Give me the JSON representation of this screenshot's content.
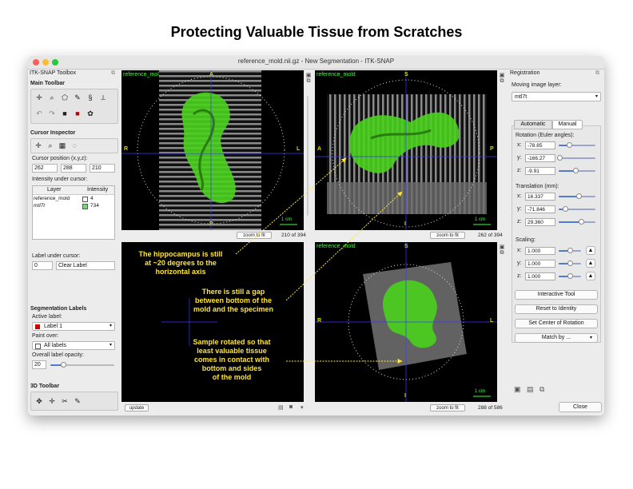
{
  "slide_title": "Protecting Valuable Tissue from Scratches",
  "window": {
    "title": "reference_mold.nii.gz - New Segmentation - ITK-SNAP",
    "colors": {
      "close": "#ff5f57",
      "minimize": "#febc2e",
      "maximize": "#28c840"
    }
  },
  "left_panel": {
    "title": "ITK-SNAP Toolbox",
    "main_toolbar": "Main Toolbar",
    "cursor_inspector": "Cursor Inspector",
    "cursor_position_label": "Cursor position (x,y,z):",
    "cursor_x": "262",
    "cursor_y": "288",
    "cursor_z": "210",
    "intensity_label": "Intensity under cursor:",
    "table_headers": [
      "Layer",
      "Intensity"
    ],
    "layers": [
      {
        "name": "reference_mold",
        "intensity": "4"
      },
      {
        "name": "mtl7t",
        "intensity": "734"
      }
    ],
    "label_under_cursor": "Label under cursor:",
    "label_value": "0",
    "label_name": "Clear Label",
    "segmentation_labels": "Segmentation Labels",
    "active_label_caption": "Active label:",
    "active_label": "Label 1",
    "paint_over_caption": "Paint over:",
    "paint_over": "All labels",
    "opacity_caption": "Overall label opacity:",
    "opacity_value": "20",
    "toolbar_3d": "3D Toolbar"
  },
  "views": {
    "top_left": {
      "label": "",
      "slice": "210 of 394",
      "zoom": "zoom to fit",
      "scale": "1 cm",
      "orient": {
        "top": "A",
        "bottom": "P",
        "left": "R",
        "right": "L"
      }
    },
    "top_right": {
      "label": "reference_mold",
      "slice": "262 of 394",
      "zoom": "zoom to fit",
      "scale": "1 cm",
      "orient": {
        "top": "S",
        "bottom": "I",
        "left": "A",
        "right": "P"
      }
    },
    "bottom_left": {
      "label": "reference_mold",
      "update": "update"
    },
    "bottom_right": {
      "label": "reference_mold",
      "slice": "288 of 586",
      "zoom": "zoom to fit",
      "scale": "1 cm",
      "orient": {
        "top": "S",
        "bottom": "I",
        "left": "R",
        "right": "L"
      }
    }
  },
  "top_left_label": "reference_mold",
  "annotations": {
    "a1": [
      "The hippocampus is still",
      "at ~20 degrees to the",
      "horizontal axis"
    ],
    "a2": [
      "There is still a gap",
      "between bottom of the",
      "mold and the specimen"
    ],
    "a3": [
      "Sample rotated so that",
      "least valuable tissue",
      "comes in contact with",
      "bottom and sides",
      "of the mold"
    ]
  },
  "right_panel": {
    "title": "Registration",
    "moving_label": "Moving image layer:",
    "moving_value": "mtl7t",
    "tabs": [
      "Automatic",
      "Manual"
    ],
    "rotation_label": "Rotation (Euler angles):",
    "rotation": [
      {
        "axis": "x:",
        "value": "-78.85",
        "level": 0.28
      },
      {
        "axis": "y:",
        "value": "-166.27",
        "level": 0.03
      },
      {
        "axis": "z:",
        "value": "-9.91",
        "level": 0.45
      }
    ],
    "translation_label": "Translation (mm):",
    "translation": [
      {
        "axis": "x:",
        "value": "16.337",
        "level": 0.55
      },
      {
        "axis": "y:",
        "value": "-71.846",
        "level": 0.18
      },
      {
        "axis": "z:",
        "value": "29.360",
        "level": 0.6
      }
    ],
    "scaling_label": "Scaling:",
    "scaling": [
      {
        "axis": "x:",
        "value": "1.000",
        "level": 0.5
      },
      {
        "axis": "y:",
        "value": "1.000",
        "level": 0.5
      },
      {
        "axis": "z:",
        "value": "1.000",
        "level": 0.5
      }
    ],
    "interactive_tool": "Interactive Tool",
    "reset": "Reset to Identity",
    "set_center": "Set Center of Rotation",
    "match_by": "Match by ...",
    "close": "Close"
  }
}
